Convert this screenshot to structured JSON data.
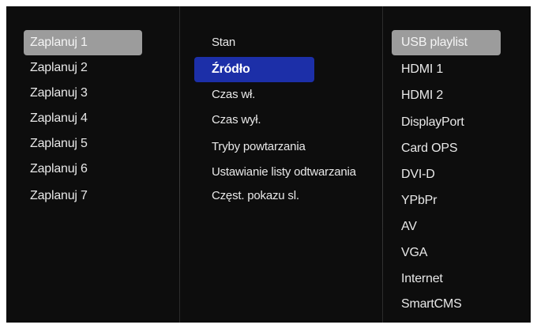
{
  "colors": {
    "screen_background": "#0d0d0d",
    "text": "#e8e8e8",
    "highlight": "#9c9c9c",
    "selected": "#1c2fa8"
  },
  "schedules": {
    "items": [
      "Zaplanuj 1",
      "Zaplanuj 2",
      "Zaplanuj 3",
      "Zaplanuj 4",
      "Zaplanuj 5",
      "Zaplanuj 6",
      "Zaplanuj 7"
    ],
    "highlighted_index": 0
  },
  "settings": {
    "items": [
      "Stan",
      "Źródło",
      "Czas wł.",
      "Czas wył.",
      "Tryby powtarzania",
      "Ustawianie listy odtwarzania",
      "Częst. pokazu sl."
    ],
    "selected_index": 1
  },
  "sources": {
    "items": [
      "USB playlist",
      "HDMI 1",
      "HDMI 2",
      "DisplayPort",
      "Card OPS",
      "DVI-D",
      "YPbPr",
      "AV",
      "VGA",
      "Internet",
      "SmartCMS"
    ],
    "highlighted_index": 0
  }
}
